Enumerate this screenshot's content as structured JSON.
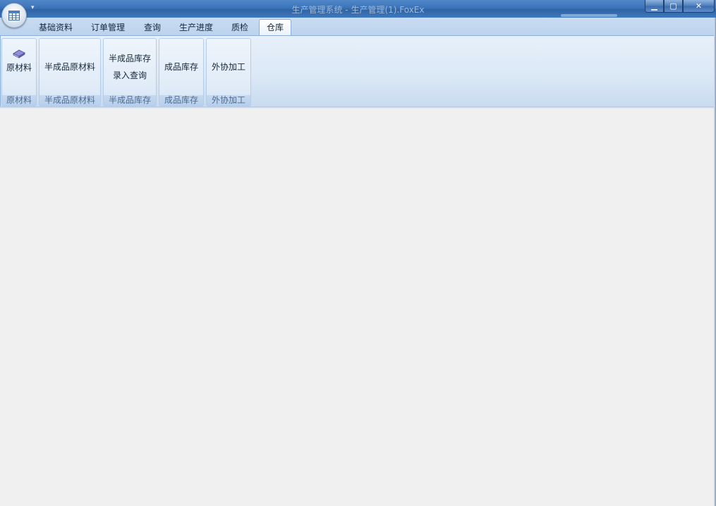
{
  "window": {
    "title": "生产管理系统 - 生产管理(1).FoxEx",
    "quick_access_arrow": "▾",
    "controls": {
      "minimize": "▁",
      "maximize": "▢",
      "close": "✕"
    }
  },
  "tabs": [
    {
      "label": "基础资料",
      "active": false
    },
    {
      "label": "订单管理",
      "active": false
    },
    {
      "label": "查询",
      "active": false
    },
    {
      "label": "生产进度",
      "active": false
    },
    {
      "label": "质检",
      "active": false
    },
    {
      "label": "仓库",
      "active": true
    }
  ],
  "ribbon": {
    "groups": [
      {
        "button_lines": [
          "原材料"
        ],
        "label": "原材料",
        "icon": "book-icon"
      },
      {
        "button_lines": [
          "半成品原材料"
        ],
        "label": "半成品原材料"
      },
      {
        "button_lines": [
          "半成品库存",
          "录入查询"
        ],
        "label": "半成品库存"
      },
      {
        "button_lines": [
          "成品库存"
        ],
        "label": "成品库存"
      },
      {
        "button_lines": [
          "外协加工"
        ],
        "label": "外协加工"
      }
    ]
  },
  "colors": {
    "titlebar": "#3a73b8",
    "ribbon": "#dbe8f6",
    "workspace": "#f0f0f0"
  }
}
